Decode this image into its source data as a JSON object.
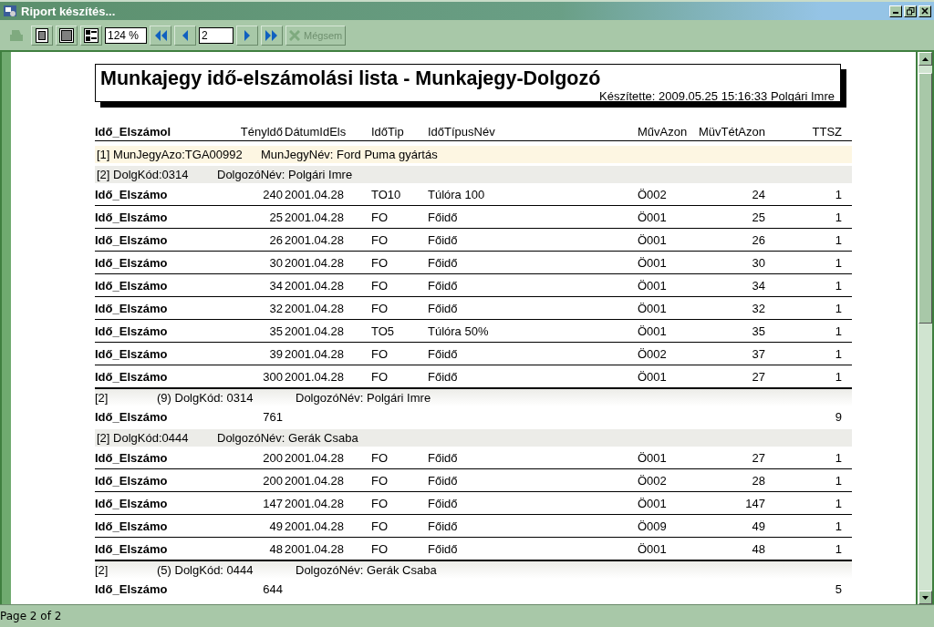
{
  "window": {
    "title": "Riport készítés..."
  },
  "toolbar": {
    "items": [
      {
        "kind": "print",
        "disabled": true
      },
      {
        "kind": "page-single",
        "disabled": false
      },
      {
        "kind": "page-two",
        "disabled": false
      },
      {
        "kind": "page-multi",
        "disabled": false
      },
      {
        "kind": "zoom",
        "value": "124 %"
      },
      {
        "kind": "first",
        "disabled": false
      },
      {
        "kind": "prev",
        "disabled": false
      },
      {
        "kind": "page",
        "value": "2"
      },
      {
        "kind": "next",
        "disabled": false
      },
      {
        "kind": "last",
        "disabled": false
      },
      {
        "kind": "cancel",
        "label": "Mégsem",
        "disabled": true
      }
    ]
  },
  "report": {
    "title": "Munkajegy idő-elszámolási lista - Munkajegy-Dolgozó",
    "subtitle": "Készítette:  2009.05.25 15:16:33 Polgári Imre",
    "columns": [
      "Idő_Elszámol",
      "Tényldő",
      "DátumIdEls",
      "IdőTip",
      "IdőTípusNév",
      "MűvAzon",
      "MüvTétAzon",
      "TTSZ"
    ],
    "ticket": {
      "prefix": "[1]",
      "id_label": "MunJegyAzo:",
      "id": "TGA00992",
      "name_label": "MunJegyNév:",
      "name": "Ford Puma gyártás"
    },
    "groups": [
      {
        "header": {
          "prefix": "[2]",
          "code_label": "DolgKód:",
          "code": "0314",
          "name_label": "DolgozóNév:",
          "name": "Polgári Imre"
        },
        "rows": [
          [
            "Idő_Elszámo",
            "240",
            "2001.04.28",
            "TO10",
            "Túlóra 100",
            "Ö002",
            "24",
            "1"
          ],
          [
            "Idő_Elszámo",
            "25",
            "2001.04.28",
            "FO",
            "Főidő",
            "Ö001",
            "25",
            "1"
          ],
          [
            "Idő_Elszámo",
            "26",
            "2001.04.28",
            "FO",
            "Főidő",
            "Ö001",
            "26",
            "1"
          ],
          [
            "Idő_Elszámo",
            "30",
            "2001.04.28",
            "FO",
            "Főidő",
            "Ö001",
            "30",
            "1"
          ],
          [
            "Idő_Elszámo",
            "34",
            "2001.04.28",
            "FO",
            "Főidő",
            "Ö001",
            "34",
            "1"
          ],
          [
            "Idő_Elszámo",
            "32",
            "2001.04.28",
            "FO",
            "Főidő",
            "Ö001",
            "32",
            "1"
          ],
          [
            "Idő_Elszámo",
            "35",
            "2001.04.28",
            "TO5",
            "Túlóra 50%",
            "Ö001",
            "35",
            "1"
          ],
          [
            "Idő_Elszámo",
            "39",
            "2001.04.28",
            "FO",
            "Főidő",
            "Ö002",
            "37",
            "1"
          ],
          [
            "Idő_Elszámo",
            "300",
            "2001.04.28",
            "FO",
            "Főidő",
            "Ö001",
            "27",
            "1"
          ]
        ],
        "footer": {
          "prefix": "[2]",
          "count": "(9)",
          "code_label": "DolgKód:",
          "code": "0314",
          "name_label": "DolgozóNév:",
          "name": "Polgári Imre"
        },
        "total": {
          "label": "Idő_Elszámo",
          "sum": "761",
          "count": "9"
        }
      },
      {
        "header": {
          "prefix": "[2]",
          "code_label": "DolgKód:",
          "code": "0444",
          "name_label": "DolgozóNév:",
          "name": "Gerák Csaba"
        },
        "rows": [
          [
            "Idő_Elszámo",
            "200",
            "2001.04.28",
            "FO",
            "Főidő",
            "Ö001",
            "27",
            "1"
          ],
          [
            "Idő_Elszámo",
            "200",
            "2001.04.28",
            "FO",
            "Főidő",
            "Ö002",
            "28",
            "1"
          ],
          [
            "Idő_Elszámo",
            "147",
            "2001.04.28",
            "FO",
            "Főidő",
            "Ö001",
            "147",
            "1"
          ],
          [
            "Idő_Elszámo",
            "49",
            "2001.04.28",
            "FO",
            "Főidő",
            "Ö009",
            "49",
            "1"
          ],
          [
            "Idő_Elszámo",
            "48",
            "2001.04.28",
            "FO",
            "Főidő",
            "Ö001",
            "48",
            "1"
          ]
        ],
        "footer": {
          "prefix": "[2]",
          "count": "(5)",
          "code_label": "DolgKód:",
          "code": "0444",
          "name_label": "DolgozóNév:",
          "name": "Gerák Csaba"
        },
        "total": {
          "label": "Idő_Elszámo",
          "sum": "644",
          "count": "5"
        }
      }
    ]
  },
  "status_bar": {
    "text": "Page 2 of 2"
  }
}
